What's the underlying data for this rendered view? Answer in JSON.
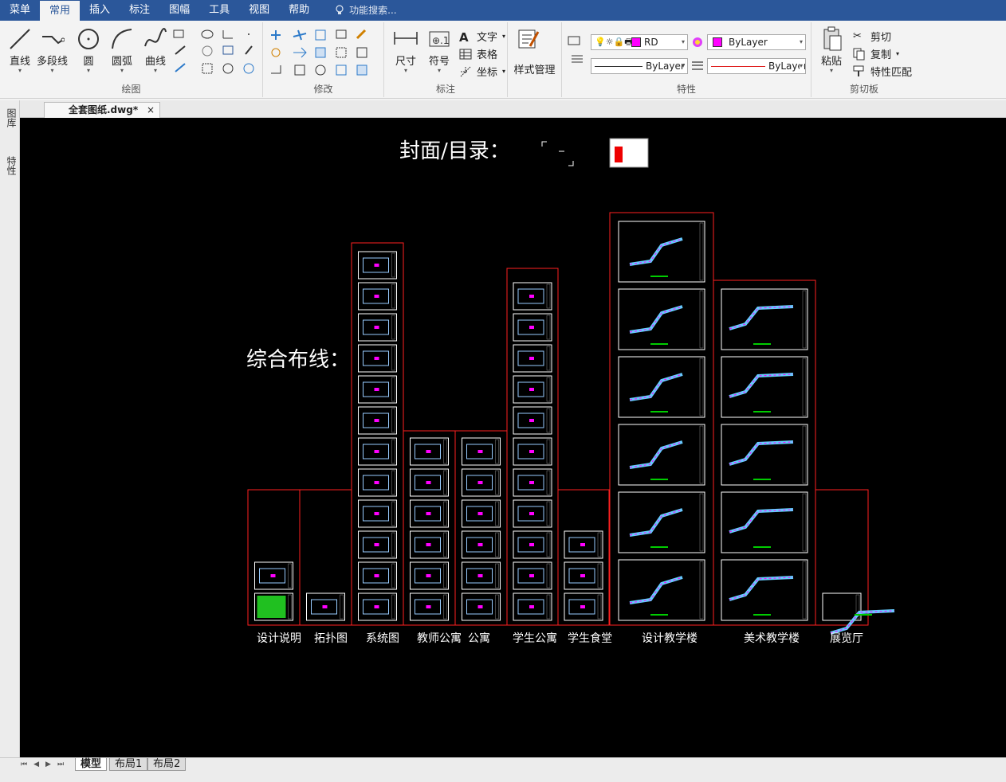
{
  "menubar": {
    "items": [
      "菜单",
      "常用",
      "插入",
      "标注",
      "图幅",
      "工具",
      "视图",
      "帮助"
    ],
    "active": "常用",
    "search_label": "功能搜索..."
  },
  "ribbon": {
    "draw": {
      "label": "绘图",
      "line": "直线",
      "polyline": "多段线",
      "circle": "圆",
      "arc": "圆弧",
      "curve": "曲线"
    },
    "modify": {
      "label": "修改"
    },
    "annot": {
      "label": "标注",
      "dim": "尺寸",
      "symbol": "符号",
      "text": "文字",
      "table": "表格",
      "coord": "坐标"
    },
    "style": {
      "label": "样式管理"
    },
    "props": {
      "label": "特性",
      "layer": "RD",
      "color": "ByLayer",
      "linetype": "ByLayer",
      "lineweight": "ByLayer"
    },
    "clipboard": {
      "label": "剪切板",
      "paste": "粘贴",
      "cut": "剪切",
      "copy": "复制",
      "match": "特性匹配"
    }
  },
  "doc_tab": {
    "title": "全套图纸.dwg*",
    "close": "×"
  },
  "left_panel": {
    "library": "图库",
    "properties": "特性"
  },
  "layout_tabs": [
    "模型",
    "布局1",
    "布局2"
  ],
  "drawing": {
    "cover_label": "封面/目录：",
    "cabling_label": "综合布线：",
    "columns": [
      "设计说明",
      "拓扑图",
      "系统图",
      "教师公寓",
      "公寓",
      "学生公寓",
      "学生食堂",
      "设计教学楼",
      "美术教学楼",
      "展览厅"
    ]
  },
  "colors": {
    "accent": "#2b579a",
    "frame": "#ff2020",
    "layer_color": "#ff00ff"
  }
}
